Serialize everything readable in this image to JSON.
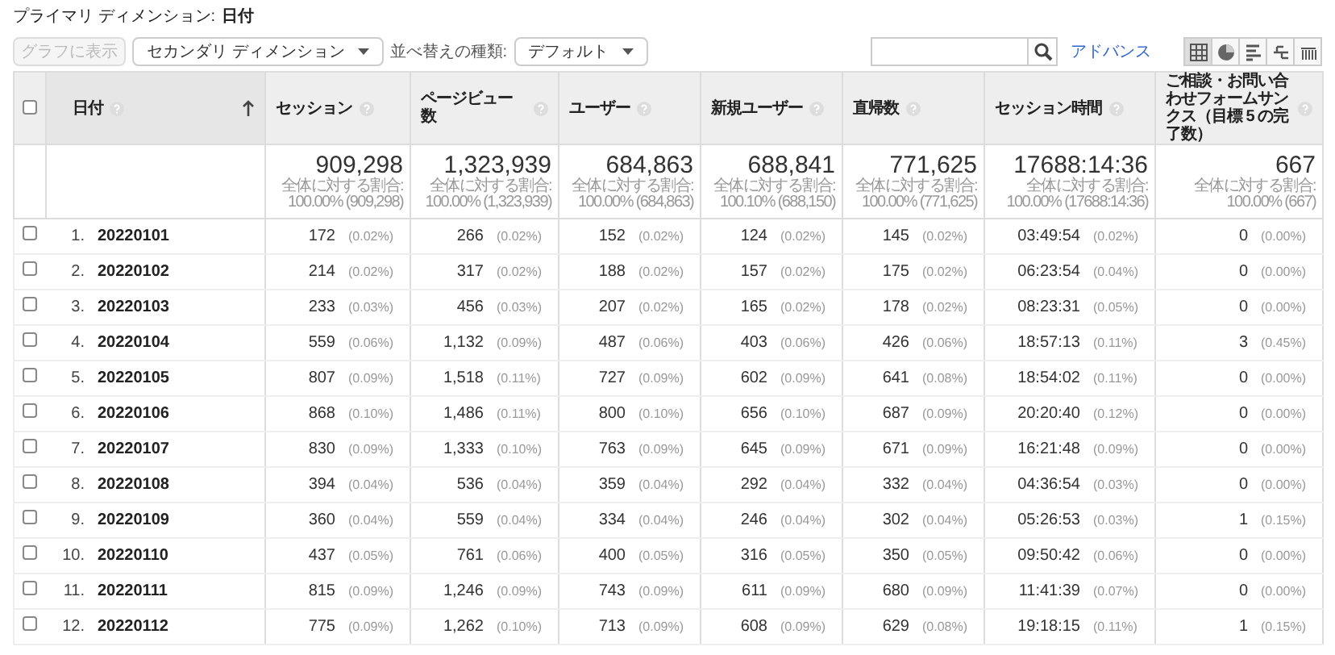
{
  "primary_dimension": {
    "label": "プライマリ ディメンション:",
    "value": "日付"
  },
  "toolbar": {
    "chart_button": {
      "label": "グラフに表示",
      "disabled": true
    },
    "secondary_dimension": "セカンダリ ディメンション",
    "sort_label": "並べ替えの種類:",
    "sort_type": "デフォルト",
    "advanced_link": "アドバンス",
    "view_buttons": [
      {
        "kind": "table",
        "selected": true
      },
      {
        "kind": "pie",
        "selected": false
      },
      {
        "kind": "bars",
        "selected": false
      },
      {
        "kind": "compare",
        "selected": false
      },
      {
        "kind": "pivot",
        "selected": false
      }
    ]
  },
  "table": {
    "select_all": {
      "checked": false
    },
    "columns": [
      {
        "label": "日付",
        "sorted": true
      },
      {
        "label": "セッション",
        "sorted": false
      },
      {
        "label": "ページビュー数",
        "sorted": false
      },
      {
        "label": "ユーザー",
        "sorted": false
      },
      {
        "label": "新規ユーザー",
        "sorted": false
      },
      {
        "label": "直帰数",
        "sorted": false
      },
      {
        "label": "セッション時間",
        "sorted": false
      },
      {
        "label": "ご相談・お問い合わせフォームサンクス（目標 5 の完了数）",
        "sorted": false
      }
    ],
    "totals": [
      {
        "value": "909,298",
        "share": "全体に対する割合: 100.00% (909,298)"
      },
      {
        "value": "1,323,939",
        "share": "全体に対する割合: 100.00% (1,323,939)"
      },
      {
        "value": "684,863",
        "share": "全体に対する割合: 100.00% (684,863)"
      },
      {
        "value": "688,841",
        "share": "全体に対する割合: 100.10% (688,150)"
      },
      {
        "value": "771,625",
        "share": "全体に対する割合: 100.00% (771,625)"
      },
      {
        "value": "17688:14:36",
        "share": "全体に対する割合: 100.00% (17688:14:36)"
      },
      {
        "value": "667",
        "share": "全体に対する割合: 100.00% (667)"
      }
    ],
    "rows": [
      {
        "index": "1.",
        "checked": false,
        "cells": [
          {
            "value": "20220101"
          },
          {
            "value": "172",
            "percent": "(0.02%)"
          },
          {
            "value": "266",
            "percent": "(0.02%)"
          },
          {
            "value": "152",
            "percent": "(0.02%)"
          },
          {
            "value": "124",
            "percent": "(0.02%)"
          },
          {
            "value": "145",
            "percent": "(0.02%)"
          },
          {
            "value": "03:49:54",
            "percent": "(0.02%)"
          },
          {
            "value": "0",
            "percent": "(0.00%)"
          }
        ]
      },
      {
        "index": "2.",
        "checked": false,
        "cells": [
          {
            "value": "20220102"
          },
          {
            "value": "214",
            "percent": "(0.02%)"
          },
          {
            "value": "317",
            "percent": "(0.02%)"
          },
          {
            "value": "188",
            "percent": "(0.02%)"
          },
          {
            "value": "157",
            "percent": "(0.02%)"
          },
          {
            "value": "175",
            "percent": "(0.02%)"
          },
          {
            "value": "06:23:54",
            "percent": "(0.04%)"
          },
          {
            "value": "0",
            "percent": "(0.00%)"
          }
        ]
      },
      {
        "index": "3.",
        "checked": false,
        "cells": [
          {
            "value": "20220103"
          },
          {
            "value": "233",
            "percent": "(0.03%)"
          },
          {
            "value": "456",
            "percent": "(0.03%)"
          },
          {
            "value": "207",
            "percent": "(0.02%)"
          },
          {
            "value": "165",
            "percent": "(0.02%)"
          },
          {
            "value": "178",
            "percent": "(0.02%)"
          },
          {
            "value": "08:23:31",
            "percent": "(0.05%)"
          },
          {
            "value": "0",
            "percent": "(0.00%)"
          }
        ]
      },
      {
        "index": "4.",
        "checked": false,
        "cells": [
          {
            "value": "20220104"
          },
          {
            "value": "559",
            "percent": "(0.06%)"
          },
          {
            "value": "1,132",
            "percent": "(0.09%)"
          },
          {
            "value": "487",
            "percent": "(0.06%)"
          },
          {
            "value": "403",
            "percent": "(0.06%)"
          },
          {
            "value": "426",
            "percent": "(0.06%)"
          },
          {
            "value": "18:57:13",
            "percent": "(0.11%)"
          },
          {
            "value": "3",
            "percent": "(0.45%)"
          }
        ]
      },
      {
        "index": "5.",
        "checked": false,
        "cells": [
          {
            "value": "20220105"
          },
          {
            "value": "807",
            "percent": "(0.09%)"
          },
          {
            "value": "1,518",
            "percent": "(0.11%)"
          },
          {
            "value": "727",
            "percent": "(0.09%)"
          },
          {
            "value": "602",
            "percent": "(0.09%)"
          },
          {
            "value": "641",
            "percent": "(0.08%)"
          },
          {
            "value": "18:54:02",
            "percent": "(0.11%)"
          },
          {
            "value": "0",
            "percent": "(0.00%)"
          }
        ]
      },
      {
        "index": "6.",
        "checked": false,
        "cells": [
          {
            "value": "20220106"
          },
          {
            "value": "868",
            "percent": "(0.10%)"
          },
          {
            "value": "1,486",
            "percent": "(0.11%)"
          },
          {
            "value": "800",
            "percent": "(0.10%)"
          },
          {
            "value": "656",
            "percent": "(0.10%)"
          },
          {
            "value": "687",
            "percent": "(0.09%)"
          },
          {
            "value": "20:20:40",
            "percent": "(0.12%)"
          },
          {
            "value": "0",
            "percent": "(0.00%)"
          }
        ]
      },
      {
        "index": "7.",
        "checked": false,
        "cells": [
          {
            "value": "20220107"
          },
          {
            "value": "830",
            "percent": "(0.09%)"
          },
          {
            "value": "1,333",
            "percent": "(0.10%)"
          },
          {
            "value": "763",
            "percent": "(0.09%)"
          },
          {
            "value": "645",
            "percent": "(0.09%)"
          },
          {
            "value": "671",
            "percent": "(0.09%)"
          },
          {
            "value": "16:21:48",
            "percent": "(0.09%)"
          },
          {
            "value": "0",
            "percent": "(0.00%)"
          }
        ]
      },
      {
        "index": "8.",
        "checked": false,
        "cells": [
          {
            "value": "20220108"
          },
          {
            "value": "394",
            "percent": "(0.04%)"
          },
          {
            "value": "536",
            "percent": "(0.04%)"
          },
          {
            "value": "359",
            "percent": "(0.04%)"
          },
          {
            "value": "292",
            "percent": "(0.04%)"
          },
          {
            "value": "332",
            "percent": "(0.04%)"
          },
          {
            "value": "04:36:54",
            "percent": "(0.03%)"
          },
          {
            "value": "0",
            "percent": "(0.00%)"
          }
        ]
      },
      {
        "index": "9.",
        "checked": false,
        "cells": [
          {
            "value": "20220109"
          },
          {
            "value": "360",
            "percent": "(0.04%)"
          },
          {
            "value": "559",
            "percent": "(0.04%)"
          },
          {
            "value": "334",
            "percent": "(0.04%)"
          },
          {
            "value": "246",
            "percent": "(0.04%)"
          },
          {
            "value": "302",
            "percent": "(0.04%)"
          },
          {
            "value": "05:26:53",
            "percent": "(0.03%)"
          },
          {
            "value": "1",
            "percent": "(0.15%)"
          }
        ]
      },
      {
        "index": "10.",
        "checked": false,
        "cells": [
          {
            "value": "20220110"
          },
          {
            "value": "437",
            "percent": "(0.05%)"
          },
          {
            "value": "761",
            "percent": "(0.06%)"
          },
          {
            "value": "400",
            "percent": "(0.05%)"
          },
          {
            "value": "316",
            "percent": "(0.05%)"
          },
          {
            "value": "350",
            "percent": "(0.05%)"
          },
          {
            "value": "09:50:42",
            "percent": "(0.06%)"
          },
          {
            "value": "0",
            "percent": "(0.00%)"
          }
        ]
      },
      {
        "index": "11.",
        "checked": false,
        "cells": [
          {
            "value": "20220111"
          },
          {
            "value": "815",
            "percent": "(0.09%)"
          },
          {
            "value": "1,246",
            "percent": "(0.09%)"
          },
          {
            "value": "743",
            "percent": "(0.09%)"
          },
          {
            "value": "611",
            "percent": "(0.09%)"
          },
          {
            "value": "680",
            "percent": "(0.09%)"
          },
          {
            "value": "11:41:39",
            "percent": "(0.07%)"
          },
          {
            "value": "0",
            "percent": "(0.00%)"
          }
        ]
      },
      {
        "index": "12.",
        "checked": false,
        "cells": [
          {
            "value": "20220112"
          },
          {
            "value": "775",
            "percent": "(0.09%)"
          },
          {
            "value": "1,262",
            "percent": "(0.10%)"
          },
          {
            "value": "713",
            "percent": "(0.09%)"
          },
          {
            "value": "608",
            "percent": "(0.09%)"
          },
          {
            "value": "629",
            "percent": "(0.08%)"
          },
          {
            "value": "19:18:15",
            "percent": "(0.11%)"
          },
          {
            "value": "1",
            "percent": "(0.15%)"
          }
        ]
      }
    ]
  }
}
